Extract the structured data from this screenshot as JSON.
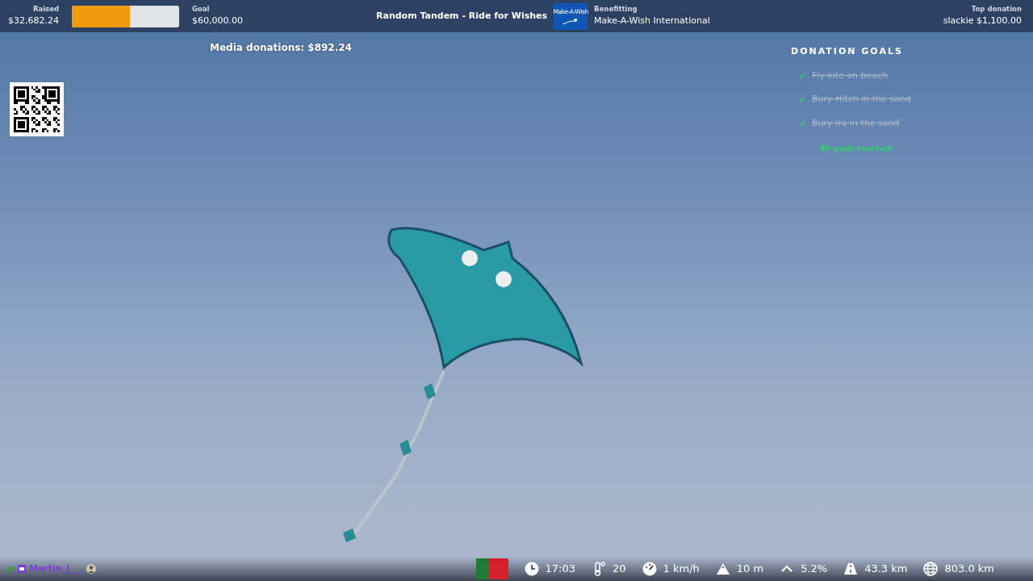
{
  "top_bar": {
    "raised": {
      "label": "Raised",
      "value": "$32,682.24"
    },
    "progress": {
      "level": 0.545
    },
    "goal": {
      "label": "Goal",
      "value": "$60,000.00"
    },
    "title": "Random Tandem - Ride for Wishes",
    "charity_logo": {
      "text": "Make-A-Wish"
    },
    "charity": {
      "label": "Benefitting",
      "value": "Make-A-Wish International"
    },
    "top_donation": {
      "label": "Top donation",
      "value": "slackie $1,100.00"
    }
  },
  "media_donations": "Media donations: $892.24",
  "donation_goals": {
    "title": "DONATION GOALS",
    "items": [
      {
        "text": "Fly kite on beach",
        "done": true
      },
      {
        "text": "Bury Hitch in the sand",
        "done": true
      },
      {
        "text": "Bury Ira in the sand",
        "done": true
      }
    ],
    "status": "All goals reached!"
  },
  "chat": {
    "username": "Martin_J___"
  },
  "stats": [
    {
      "kind": "clock",
      "value": "17:03"
    },
    {
      "kind": "temperature",
      "value": "20"
    },
    {
      "kind": "speed",
      "value": "1 km/h"
    },
    {
      "kind": "altitude",
      "value": "10 m"
    },
    {
      "kind": "grade",
      "value": "5.2%"
    },
    {
      "kind": "distance",
      "value": "43.3 km"
    },
    {
      "kind": "globe",
      "value": "803.0 km"
    }
  ]
}
